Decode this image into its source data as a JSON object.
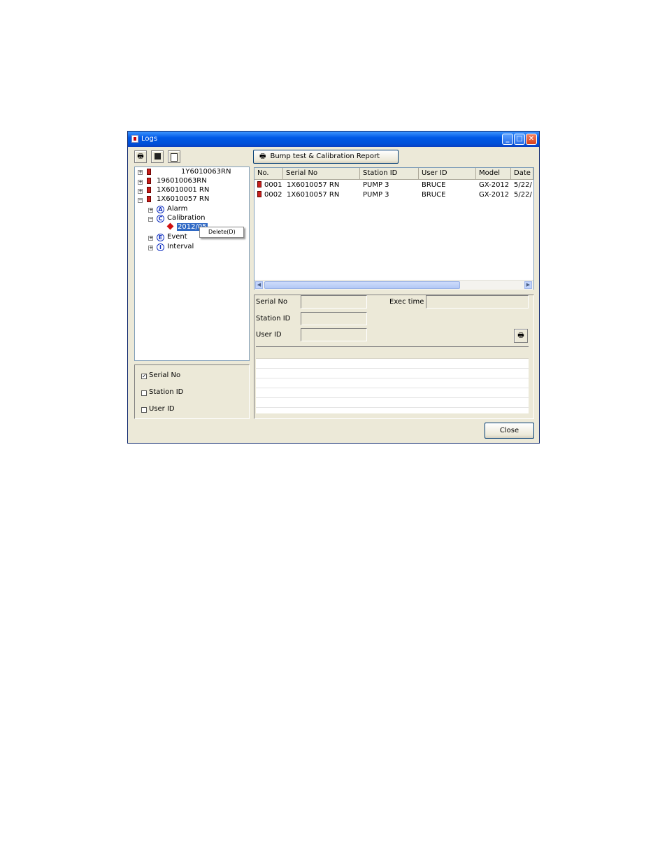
{
  "window": {
    "title": "Logs",
    "minimize": "_",
    "maximize": "□",
    "close": "✕"
  },
  "toolbar": {
    "report_label": "Bump test & Calibration Report"
  },
  "tree": {
    "devices": [
      "1Y6010063RN",
      "196010063RN",
      "1X6010001 RN",
      "1X6010057 RN"
    ],
    "children": [
      {
        "letter": "A",
        "label": "Alarm"
      },
      {
        "letter": "C",
        "label": "Calibration"
      },
      {
        "letter": "E",
        "label": "Event"
      },
      {
        "letter": "I",
        "label": "Interval"
      }
    ],
    "selected": "2012/05"
  },
  "context_menu": {
    "item": "Delete(D)"
  },
  "table": {
    "columns": [
      "No.",
      "Serial No",
      "Station ID",
      "User ID",
      "Model",
      "Date"
    ],
    "rows": [
      [
        "0001",
        "1X6010057 RN",
        "PUMP 3",
        "BRUCE",
        "GX-2012",
        "5/22/"
      ],
      [
        "0002",
        "1X6010057 RN",
        "PUMP 3",
        "BRUCE",
        "GX-2012",
        "5/22/"
      ]
    ]
  },
  "details": {
    "serial_label": "Serial No",
    "station_label": "Station ID",
    "user_label": "User ID",
    "exec_label": "Exec time"
  },
  "filters": [
    {
      "label": "Serial No",
      "checked": true
    },
    {
      "label": "Station ID",
      "checked": false
    },
    {
      "label": "User ID",
      "checked": false
    }
  ],
  "footer": {
    "close_label": "Close"
  }
}
